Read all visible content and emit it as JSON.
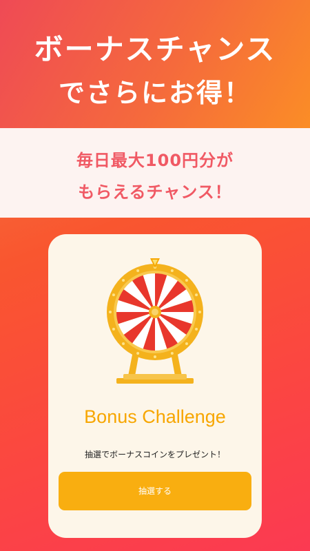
{
  "hero": {
    "line1": "ボーナスチャンス",
    "line2": "でさらにお得！"
  },
  "band": {
    "line1": "毎日最大100円分が",
    "line2": "もらえるチャンス！"
  },
  "card": {
    "title": "Bonus Challenge",
    "description": "抽選でボーナスコインをプレゼント！",
    "button_label": "抽選する",
    "wheel_icon": "prize-wheel-icon"
  },
  "colors": {
    "accent_orange": "#f9ae10",
    "title_orange": "#f7a600",
    "band_text": "#f05964",
    "wheel_red": "#e8372c",
    "wheel_gold": "#f4b21d"
  }
}
